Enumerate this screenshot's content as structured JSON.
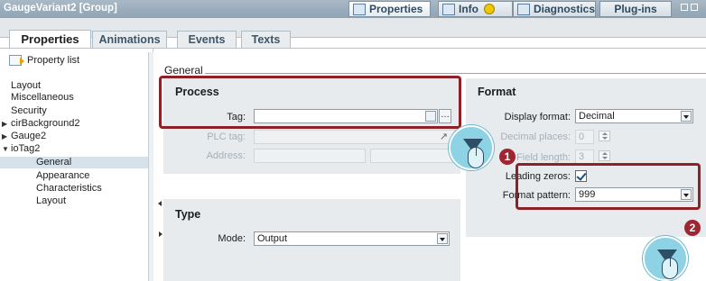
{
  "window": {
    "title": "GaugeVariant2 [Group]"
  },
  "top_tabs": [
    {
      "label": "Properties",
      "icon": "properties-icon"
    },
    {
      "label": "Info",
      "icon": "info-icon",
      "badge_icon": "info-badge-icon"
    },
    {
      "label": "Diagnostics",
      "icon": "diagnostics-icon"
    },
    {
      "label": "Plug-ins"
    }
  ],
  "inspector_tabs": [
    "Properties",
    "Animations",
    "Events",
    "Texts"
  ],
  "sidebar": {
    "header": "Property list",
    "items": [
      {
        "label": "Layout",
        "expander": "",
        "indent": 0
      },
      {
        "label": "Miscellaneous",
        "expander": "",
        "indent": 0
      },
      {
        "label": "Security",
        "expander": "",
        "indent": 0
      },
      {
        "label": "cirBackground2",
        "expander": "▶",
        "indent": 0
      },
      {
        "label": "Gauge2",
        "expander": "▶",
        "indent": 0
      },
      {
        "label": "ioTag2",
        "expander": "▼",
        "indent": 0
      },
      {
        "label": "General",
        "expander": "",
        "indent": 1,
        "selected": true
      },
      {
        "label": "Appearance",
        "expander": "",
        "indent": 1
      },
      {
        "label": "Characteristics",
        "expander": "",
        "indent": 1
      },
      {
        "label": "Layout",
        "expander": "",
        "indent": 1
      }
    ]
  },
  "main": {
    "section_title": "General",
    "process": {
      "title": "Process",
      "tag_label": "Tag:",
      "tag_value": "",
      "plc_tag_label": "PLC tag:",
      "address_label": "Address:"
    },
    "type": {
      "title": "Type",
      "mode_label": "Mode:",
      "mode_value": "Output"
    },
    "format": {
      "title": "Format",
      "display_format_label": "Display format:",
      "display_format_value": "Decimal",
      "decimal_places_label": "Decimal places:",
      "decimal_places_value": "0",
      "field_length_label": "Field length:",
      "field_length_value": "3",
      "leading_zeros_label": "Leading zeros:",
      "leading_zeros_checked": true,
      "format_pattern_label": "Format pattern:",
      "format_pattern_value": "999"
    }
  },
  "callouts": [
    {
      "number": "1"
    },
    {
      "number": "2"
    }
  ],
  "colors": {
    "titlebar": "#9aadbc",
    "highlight_box": "#8c2128",
    "callout_number": "#9e2630",
    "cursor_badge": "#8ed2e6"
  }
}
